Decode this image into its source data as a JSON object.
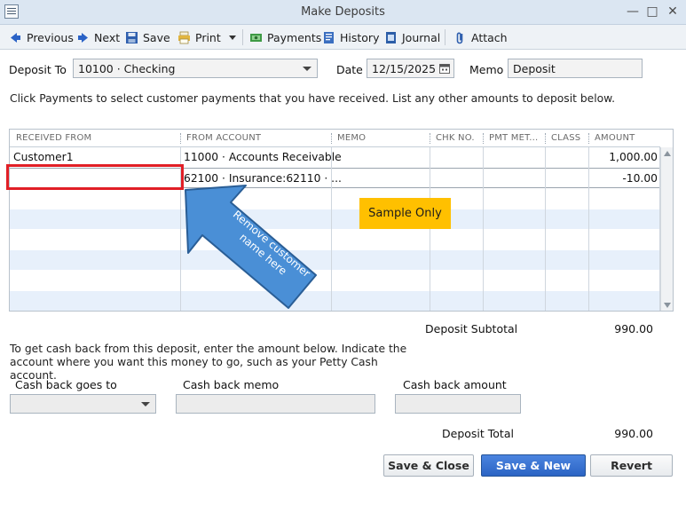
{
  "window": {
    "title": "Make Deposits"
  },
  "toolbar": {
    "previous": "Previous",
    "next": "Next",
    "save": "Save",
    "print": "Print",
    "payments": "Payments",
    "history": "History",
    "journal": "Journal",
    "attach": "Attach"
  },
  "header": {
    "deposit_to_label": "Deposit To",
    "deposit_to_value": "10100 · Checking",
    "date_label": "Date",
    "date_value": "12/15/2025",
    "memo_label": "Memo",
    "memo_value": "Deposit"
  },
  "instruction": "Click Payments to select customer payments that you have received. List any other amounts to deposit below.",
  "grid": {
    "columns": [
      "RECEIVED FROM",
      "FROM ACCOUNT",
      "MEMO",
      "CHK NO.",
      "PMT MET...",
      "CLASS",
      "AMOUNT"
    ],
    "rows": [
      {
        "received_from": "Customer1",
        "from_account": "11000 · Accounts Receivable",
        "memo": "",
        "chk_no": "",
        "pmt_method": "",
        "class": "",
        "amount": "1,000.00"
      },
      {
        "received_from": "",
        "from_account": "62100 · Insurance:62110 · ...",
        "memo": "",
        "chk_no": "",
        "pmt_method": "",
        "class": "",
        "amount": "-10.00"
      }
    ]
  },
  "annotations": {
    "arrow_text": "Remove customer name here",
    "sample_label": "Sample Only"
  },
  "totals": {
    "subtotal_label": "Deposit Subtotal",
    "subtotal_value": "990.00",
    "total_label": "Deposit Total",
    "total_value": "990.00"
  },
  "cash_back": {
    "note": "To get cash back from this deposit, enter the amount below.  Indicate the account where you want this money to go, such as your Petty Cash account.",
    "goes_to_label": "Cash back goes to",
    "memo_label": "Cash back memo",
    "amount_label": "Cash back amount"
  },
  "buttons": {
    "save_close": "Save & Close",
    "save_new": "Save & New",
    "revert": "Revert"
  },
  "colors": {
    "highlight": "#e11f26",
    "arrow_fill": "#4a8fd6",
    "sample_bg": "#ffc000",
    "primary_button": "#2f6ccb",
    "band": "#e7f0fb"
  }
}
